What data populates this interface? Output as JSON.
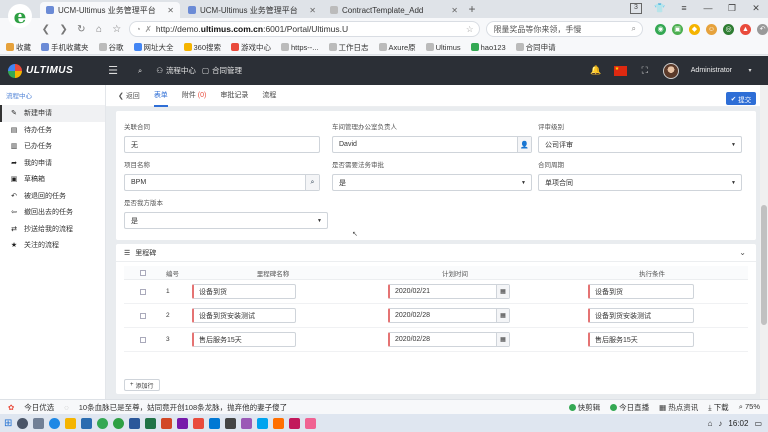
{
  "browser": {
    "tabs": [
      {
        "title": "UCM-Ultimus 业务管理平台",
        "active": true
      },
      {
        "title": "UCM-Ultimus 业务管理平台",
        "active": false
      },
      {
        "title": "ContractTemplate_Add",
        "active": false
      }
    ],
    "tab_count": "3",
    "url_prefix": "http://demo.",
    "url_domain": "ultimus.com.cn",
    "url_suffix": ":6001/Portal/Ultimus.U",
    "search_text": "限量奖品等你来领，手慢"
  },
  "bookmarks": [
    "收藏",
    "手机收藏夹",
    "谷歌",
    "网址大全",
    "360搜索",
    "游戏中心",
    "https--...",
    "工作日志",
    "Axure原",
    "Ultimus",
    "hao123",
    "合同申请"
  ],
  "header": {
    "logo": "ULTIMUS",
    "nav": [
      "流程中心",
      "合同管理"
    ],
    "user": "Administrator"
  },
  "sidebar": {
    "title": "流程中心",
    "items": [
      {
        "label": "新建申请",
        "icon": "✎"
      },
      {
        "label": "待办任务",
        "icon": "▤"
      },
      {
        "label": "已办任务",
        "icon": "▥"
      },
      {
        "label": "我的申请",
        "icon": "➦"
      },
      {
        "label": "草稿箱",
        "icon": "▣"
      },
      {
        "label": "被退回的任务",
        "icon": "↶"
      },
      {
        "label": "撤回出去的任务",
        "icon": "⇦"
      },
      {
        "label": "抄送给我的流程",
        "icon": "⇄"
      },
      {
        "label": "关注的流程",
        "icon": "★"
      }
    ]
  },
  "subnav": {
    "back": "返回",
    "tabs": [
      "表单",
      "附件",
      "审批记录",
      "流程"
    ],
    "attach_count": "(0)",
    "submit": "提交"
  },
  "form": {
    "related_contract": {
      "label": "关联合同",
      "value": "无"
    },
    "workshop_manager": {
      "label": "车间管理办公室负责人",
      "value": "David"
    },
    "review_level": {
      "label": "评审级别",
      "value": "公司评审"
    },
    "project_name": {
      "label": "项目名称",
      "value": "BPM"
    },
    "legal_review": {
      "label": "是否需要法务审批",
      "value": "是"
    },
    "contract_cycle": {
      "label": "合同周期",
      "value": "单项合同"
    },
    "our_template": {
      "label": "是否我方版本",
      "value": "是"
    }
  },
  "milestone": {
    "title": "里程碑",
    "columns": [
      "编号",
      "里程碑名称",
      "计划时间",
      "执行条件"
    ],
    "rows": [
      {
        "no": "1",
        "name": "设备到货",
        "date": "2020/02/21",
        "cond": "设备到货"
      },
      {
        "no": "2",
        "name": "设备到货安装测试",
        "date": "2020/02/28",
        "cond": "设备到货安装测试"
      },
      {
        "no": "3",
        "name": "售后服务15天",
        "date": "2020/02/28",
        "cond": "售后服务15天"
      }
    ],
    "add_row": "添加行"
  },
  "statusbar": {
    "left": [
      "今日优选",
      "10条血脉已是至尊，姑同竟开创108条龙脉，抛弃他的妻子傻了"
    ],
    "right": [
      "快剪辑",
      "今日直播",
      "热点资讯",
      "下载",
      "75%"
    ]
  },
  "taskbar": {
    "time": "16:02"
  }
}
